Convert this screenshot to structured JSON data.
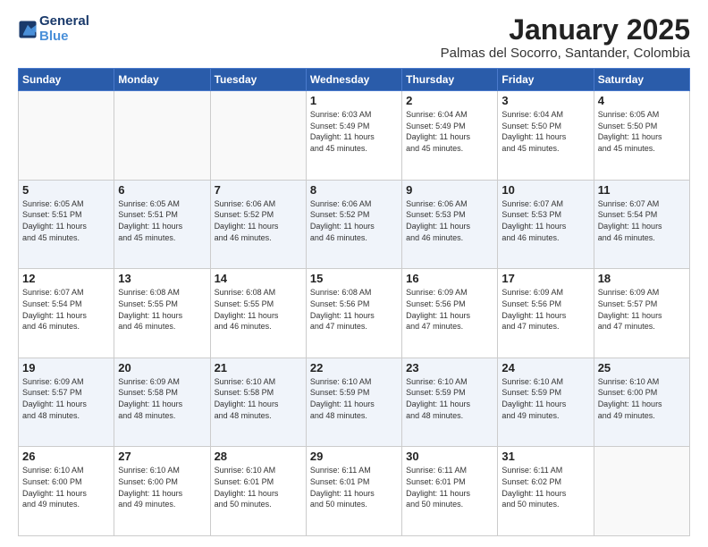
{
  "logo": {
    "line1": "General",
    "line2": "Blue"
  },
  "title": "January 2025",
  "subtitle": "Palmas del Socorro, Santander, Colombia",
  "weekdays": [
    "Sunday",
    "Monday",
    "Tuesday",
    "Wednesday",
    "Thursday",
    "Friday",
    "Saturday"
  ],
  "weeks": [
    [
      {
        "day": "",
        "info": ""
      },
      {
        "day": "",
        "info": ""
      },
      {
        "day": "",
        "info": ""
      },
      {
        "day": "1",
        "info": "Sunrise: 6:03 AM\nSunset: 5:49 PM\nDaylight: 11 hours\nand 45 minutes."
      },
      {
        "day": "2",
        "info": "Sunrise: 6:04 AM\nSunset: 5:49 PM\nDaylight: 11 hours\nand 45 minutes."
      },
      {
        "day": "3",
        "info": "Sunrise: 6:04 AM\nSunset: 5:50 PM\nDaylight: 11 hours\nand 45 minutes."
      },
      {
        "day": "4",
        "info": "Sunrise: 6:05 AM\nSunset: 5:50 PM\nDaylight: 11 hours\nand 45 minutes."
      }
    ],
    [
      {
        "day": "5",
        "info": "Sunrise: 6:05 AM\nSunset: 5:51 PM\nDaylight: 11 hours\nand 45 minutes."
      },
      {
        "day": "6",
        "info": "Sunrise: 6:05 AM\nSunset: 5:51 PM\nDaylight: 11 hours\nand 45 minutes."
      },
      {
        "day": "7",
        "info": "Sunrise: 6:06 AM\nSunset: 5:52 PM\nDaylight: 11 hours\nand 46 minutes."
      },
      {
        "day": "8",
        "info": "Sunrise: 6:06 AM\nSunset: 5:52 PM\nDaylight: 11 hours\nand 46 minutes."
      },
      {
        "day": "9",
        "info": "Sunrise: 6:06 AM\nSunset: 5:53 PM\nDaylight: 11 hours\nand 46 minutes."
      },
      {
        "day": "10",
        "info": "Sunrise: 6:07 AM\nSunset: 5:53 PM\nDaylight: 11 hours\nand 46 minutes."
      },
      {
        "day": "11",
        "info": "Sunrise: 6:07 AM\nSunset: 5:54 PM\nDaylight: 11 hours\nand 46 minutes."
      }
    ],
    [
      {
        "day": "12",
        "info": "Sunrise: 6:07 AM\nSunset: 5:54 PM\nDaylight: 11 hours\nand 46 minutes."
      },
      {
        "day": "13",
        "info": "Sunrise: 6:08 AM\nSunset: 5:55 PM\nDaylight: 11 hours\nand 46 minutes."
      },
      {
        "day": "14",
        "info": "Sunrise: 6:08 AM\nSunset: 5:55 PM\nDaylight: 11 hours\nand 46 minutes."
      },
      {
        "day": "15",
        "info": "Sunrise: 6:08 AM\nSunset: 5:56 PM\nDaylight: 11 hours\nand 47 minutes."
      },
      {
        "day": "16",
        "info": "Sunrise: 6:09 AM\nSunset: 5:56 PM\nDaylight: 11 hours\nand 47 minutes."
      },
      {
        "day": "17",
        "info": "Sunrise: 6:09 AM\nSunset: 5:56 PM\nDaylight: 11 hours\nand 47 minutes."
      },
      {
        "day": "18",
        "info": "Sunrise: 6:09 AM\nSunset: 5:57 PM\nDaylight: 11 hours\nand 47 minutes."
      }
    ],
    [
      {
        "day": "19",
        "info": "Sunrise: 6:09 AM\nSunset: 5:57 PM\nDaylight: 11 hours\nand 48 minutes."
      },
      {
        "day": "20",
        "info": "Sunrise: 6:09 AM\nSunset: 5:58 PM\nDaylight: 11 hours\nand 48 minutes."
      },
      {
        "day": "21",
        "info": "Sunrise: 6:10 AM\nSunset: 5:58 PM\nDaylight: 11 hours\nand 48 minutes."
      },
      {
        "day": "22",
        "info": "Sunrise: 6:10 AM\nSunset: 5:59 PM\nDaylight: 11 hours\nand 48 minutes."
      },
      {
        "day": "23",
        "info": "Sunrise: 6:10 AM\nSunset: 5:59 PM\nDaylight: 11 hours\nand 48 minutes."
      },
      {
        "day": "24",
        "info": "Sunrise: 6:10 AM\nSunset: 5:59 PM\nDaylight: 11 hours\nand 49 minutes."
      },
      {
        "day": "25",
        "info": "Sunrise: 6:10 AM\nSunset: 6:00 PM\nDaylight: 11 hours\nand 49 minutes."
      }
    ],
    [
      {
        "day": "26",
        "info": "Sunrise: 6:10 AM\nSunset: 6:00 PM\nDaylight: 11 hours\nand 49 minutes."
      },
      {
        "day": "27",
        "info": "Sunrise: 6:10 AM\nSunset: 6:00 PM\nDaylight: 11 hours\nand 49 minutes."
      },
      {
        "day": "28",
        "info": "Sunrise: 6:10 AM\nSunset: 6:01 PM\nDaylight: 11 hours\nand 50 minutes."
      },
      {
        "day": "29",
        "info": "Sunrise: 6:11 AM\nSunset: 6:01 PM\nDaylight: 11 hours\nand 50 minutes."
      },
      {
        "day": "30",
        "info": "Sunrise: 6:11 AM\nSunset: 6:01 PM\nDaylight: 11 hours\nand 50 minutes."
      },
      {
        "day": "31",
        "info": "Sunrise: 6:11 AM\nSunset: 6:02 PM\nDaylight: 11 hours\nand 50 minutes."
      },
      {
        "day": "",
        "info": ""
      }
    ]
  ]
}
